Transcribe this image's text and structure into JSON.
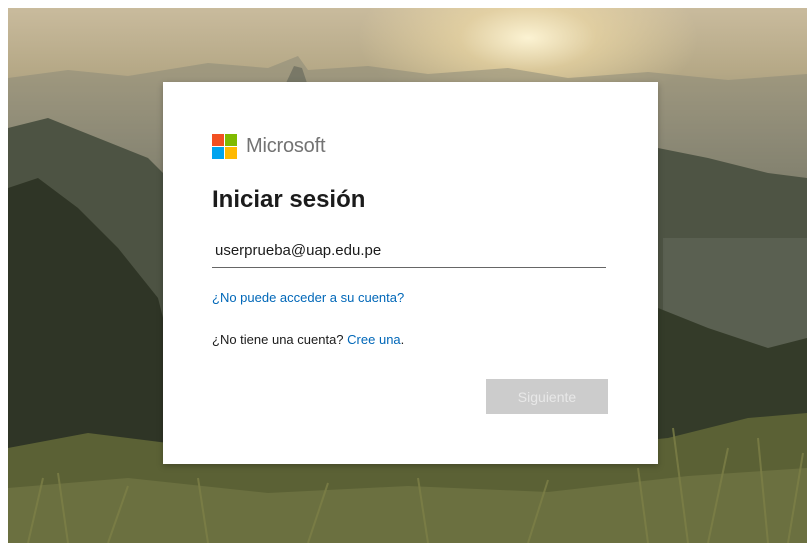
{
  "brand": {
    "name": "Microsoft",
    "logo_colors": [
      "#f25022",
      "#7fba00",
      "#00a4ef",
      "#ffb900"
    ]
  },
  "signin": {
    "title": "Iniciar sesión",
    "email_value": "userprueba@uap.edu.pe",
    "cant_access_link": "¿No puede acceder a su cuenta?",
    "no_account_text": "¿No tiene una cuenta?",
    "create_link": "Cree una",
    "create_suffix": ".",
    "next_button": "Siguiente"
  },
  "colors": {
    "link": "#0067b8",
    "button_disabled": "#cccccc"
  }
}
